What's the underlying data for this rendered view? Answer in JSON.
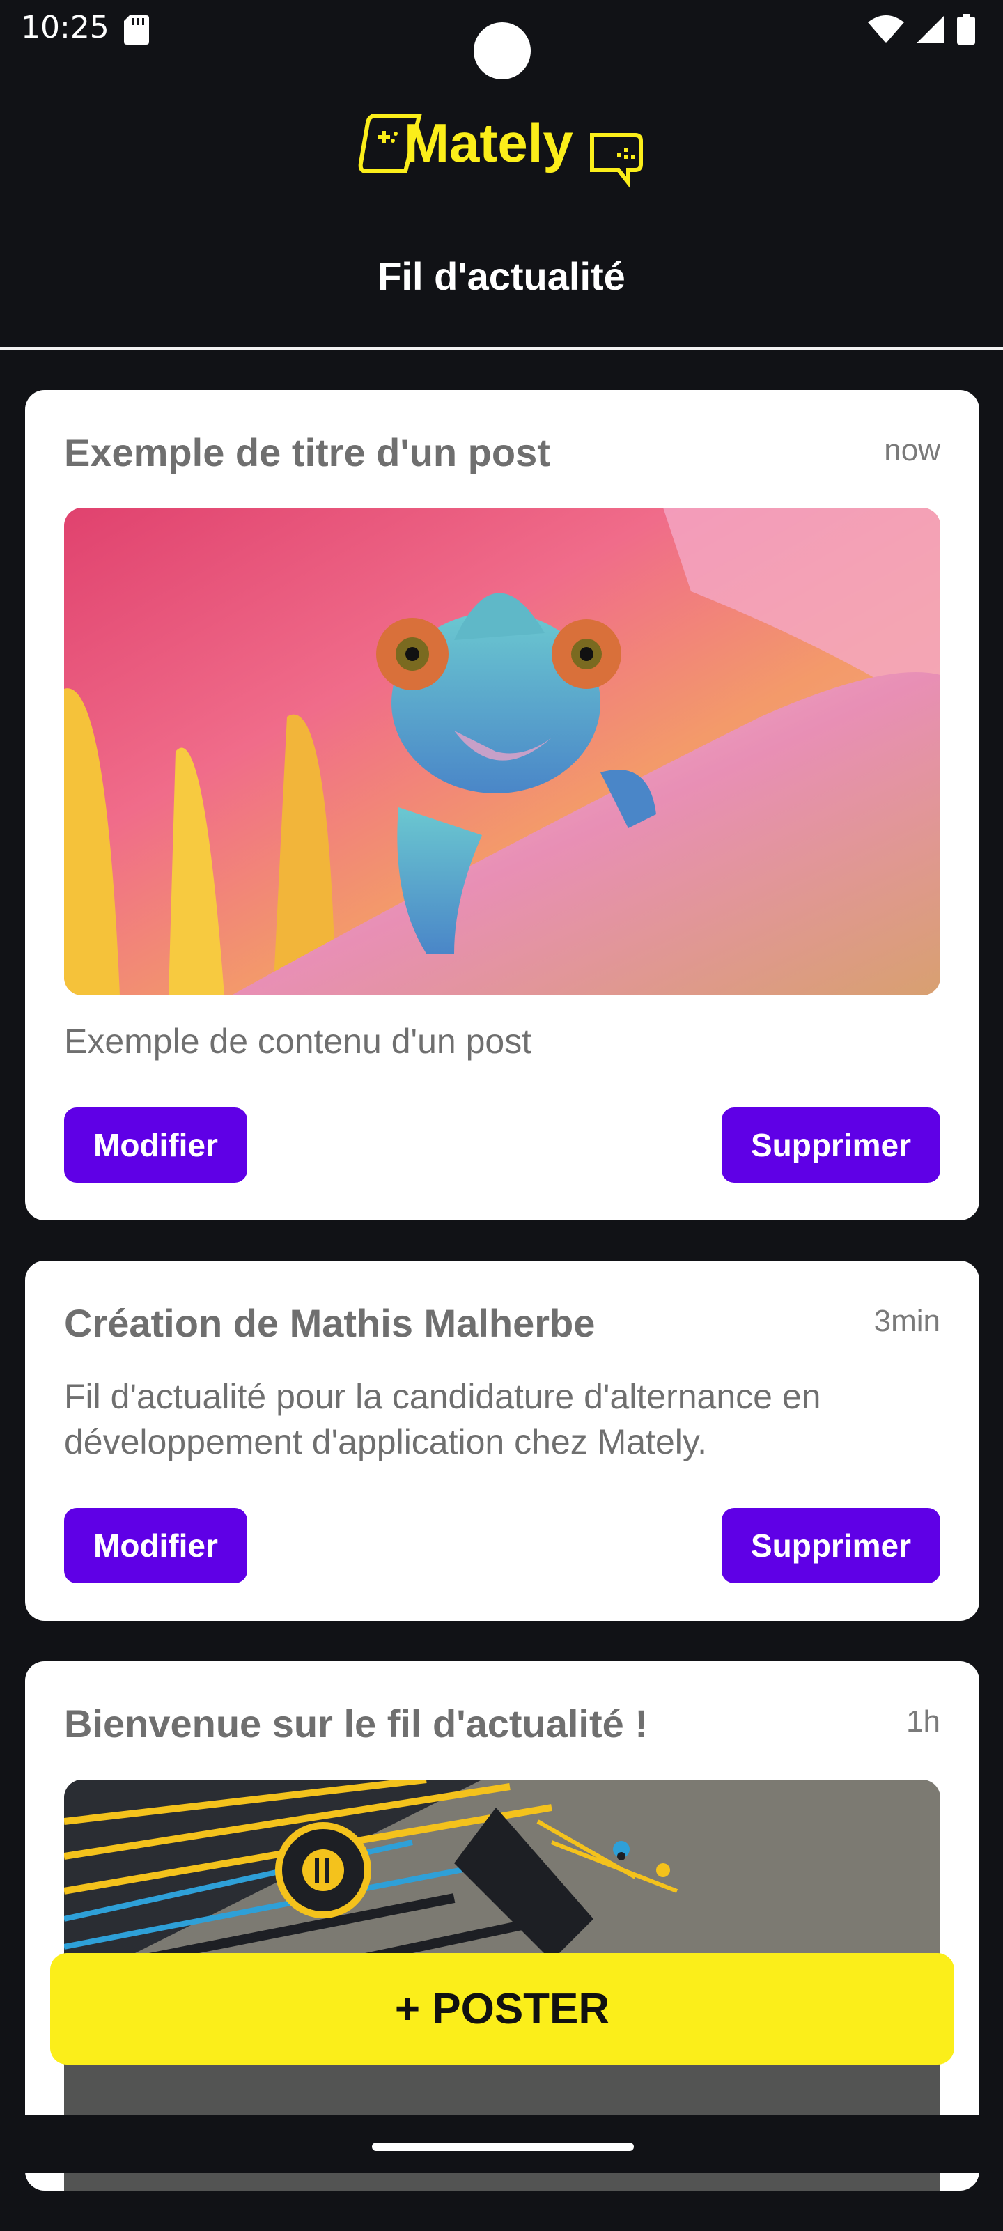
{
  "status_bar": {
    "time": "10:25"
  },
  "header": {
    "logo_text": "Mately",
    "title": "Fil d'actualité"
  },
  "posts": [
    {
      "title": "Exemple de titre d'un post",
      "time": "now",
      "image": "chameleon-on-flower-photo",
      "content": "Exemple de contenu d'un post",
      "edit_label": "Modifier",
      "delete_label": "Supprimer"
    },
    {
      "title": "Création de Mathis Malherbe",
      "time": "3min",
      "content": "Fil d'actualité pour la candidature d'alternance en développement d'application chez Mately.",
      "edit_label": "Modifier",
      "delete_label": "Supprimer"
    },
    {
      "title": "Bienvenue sur le fil d'actualité !",
      "time": "1h",
      "image": "gaming-abstract-illustration"
    }
  ],
  "poster_button": {
    "label": "+ POSTER"
  },
  "colors": {
    "accent": "#5f00e6",
    "brand_yellow": "#fbee1a",
    "background": "#111216"
  }
}
